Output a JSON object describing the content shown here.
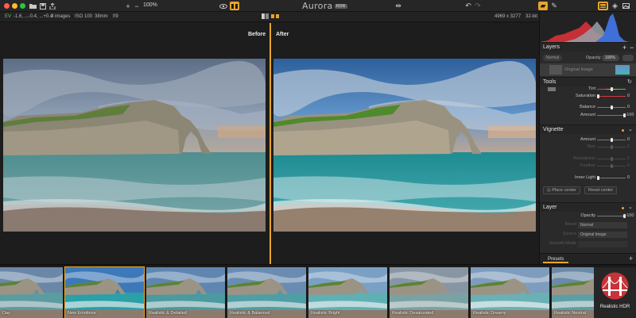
{
  "titlebar": {
    "zoom_label": "100%",
    "app_name": "Aurora",
    "app_badge": "HDR"
  },
  "infobar": {
    "ev": "EV",
    "ev_values": "-1.6, ...-0.4, ...+0.4",
    "image_count": "3 images",
    "iso": "ISO 100",
    "focal": "38mm",
    "aperture": "f/9",
    "dimensions": "4969 x 3277",
    "bit_depth": "32-bit"
  },
  "canvas": {
    "before_label": "Before",
    "after_label": "After"
  },
  "layers": {
    "title": "Layers",
    "blend_mode": "Normal",
    "opacity_label": "Opacity",
    "opacity_value": "100%",
    "layer_name": "Original Image"
  },
  "tools": {
    "title": "Tools",
    "rows": [
      {
        "label": "Tint",
        "value": "",
        "dim": false
      },
      {
        "label": "Saturation",
        "value": "0",
        "dim": false
      },
      {
        "label": "Balance",
        "value": "0",
        "dim": false
      },
      {
        "label": "Amount",
        "value": "+100",
        "dim": false
      }
    ]
  },
  "vignette": {
    "title": "Vignette",
    "rows": [
      {
        "label": "Amount",
        "value": "0",
        "dim": false
      },
      {
        "label": "Size",
        "value": "0",
        "dim": true
      },
      {
        "label": "Roundness",
        "value": "0",
        "dim": true
      },
      {
        "label": "Feather",
        "value": "0",
        "dim": true
      },
      {
        "label": "Inner Light",
        "value": "0",
        "dim": false
      }
    ],
    "place_center_label": "Place center",
    "reset_center_label": "Reset center"
  },
  "layer_section": {
    "title": "Layer",
    "opacity_label": "Opacity",
    "opacity_value": "+100",
    "blend_label": "Blend",
    "blend_value": "Normal",
    "source_label": "Source",
    "source_value": "Original Image",
    "smooth_label": "Smooth.Mode"
  },
  "presets_tab": "Presets",
  "presets": [
    {
      "name": "Day"
    },
    {
      "name": "New Emotions"
    },
    {
      "name": "Realistic & Detailed"
    },
    {
      "name": "Realistic & Balanced"
    },
    {
      "name": "Realistic Bright"
    },
    {
      "name": "Realistic Desaturated"
    },
    {
      "name": "Realistic Dreamy"
    },
    {
      "name": "Realistic Neutral"
    }
  ],
  "hdr_tile_label": "Realistic HDR",
  "colors": {
    "accent": "#e7a52a",
    "panel_bg": "#2a2a2a",
    "titlebar_bg": "#262626"
  }
}
